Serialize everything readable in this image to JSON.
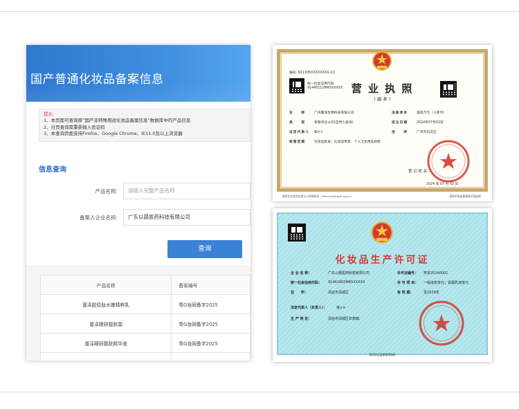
{
  "search_page": {
    "banner_title": "国产普通化妆品备案信息",
    "tips_label": "提示:",
    "tips": [
      "1、本页面可查询原“国产非特殊用途化妆品备案信息”数据库中的产品信息",
      "2、分页查询需重新输入验证码",
      "3、本查询页面支持Firefox、Google Chrome、IE11.0及以上浏览器"
    ],
    "section_title": "信息查询",
    "product_name_label": "产品名称:",
    "product_name_placeholder": "请输入完整产品名称",
    "company_label": "备案人企业名称:",
    "company_value": "广东以晨医药科技有限公司",
    "query_button": "查询",
    "table": {
      "headers": [
        "产品名称",
        "备案编号"
      ],
      "rows": [
        [
          "蔓泽胶原肽水嫩精粹乳",
          "粤G妆网备字2025"
        ],
        [
          "蔓泽臻妍靓肤霜",
          "粤G妆网备字2025"
        ],
        [
          "蔓泽臻妍靓肤精华液",
          "粤G妆网备字2025"
        ]
      ]
    }
  },
  "business_license": {
    "title": "营 业 执 照",
    "subtitle": "( 副 本 )",
    "serial": "编号: 911305XXXXXXXX-1/1",
    "credit_code_label": "统一社会信用代码",
    "credit_code_value": "91440111MA5XXXXX",
    "name_label": "名　　称",
    "name_value": "广州蔓泽生物科技有限公司",
    "type_label": "类　　型",
    "type_value": "有限责任公司(自然人投资)",
    "legal_label": "法定代表人",
    "legal_value": "蔡××",
    "scope_label": "经营范围",
    "scope_value": "化妆品批发；化妆品零售；个人卫生用品销售",
    "capital_label": "注册资本",
    "capital_value": "壹佰万元（人民币）",
    "date_label": "成立日期",
    "date_value": "2024年07月02日",
    "address_label": "住　　所",
    "address_value": "广州市白云区",
    "authority_label": "登 记 机 关",
    "issue_date": "2024 年 07 月 02 日",
    "footer_left": "国家企业信用信息公示系统网址：http://www.gsxt.gov.cn",
    "footer_right": "国家市场监督管理总局监制"
  },
  "cosmetic_license": {
    "title": "化妆品生产许可证",
    "rows": [
      {
        "label": "企 业 名 称：",
        "value": "广东以晨医药科技有限公司"
      },
      {
        "label": "统一社会信用代码：",
        "value": "91441802MA5XXXXX"
      },
      {
        "label": "住　　所：",
        "value": "清远市清城区"
      },
      {
        "label": "法定代表人（负责人）：",
        "value": "徐××"
      },
      {
        "label": "生 产 地 址：",
        "value": "清远市清城区石角镇"
      }
    ],
    "number_label": "许可证编号：",
    "number_value": "粤妆20240001",
    "items_label": "许 可 项 目：",
    "items_value": "一般液态单元；膏霜乳液单元",
    "valid_label": "有 效 期：",
    "valid_value": "至2029年",
    "footer": "国家药品监督管理局制"
  },
  "colors": {
    "banner_blue": "#3f8ee0",
    "button_blue": "#3b82d6",
    "section_blue": "#2f6fc8",
    "seal_red": "#d43a2f",
    "license_gold": "#c9a86a",
    "cosmetic_teal": "#b7e8ee"
  }
}
